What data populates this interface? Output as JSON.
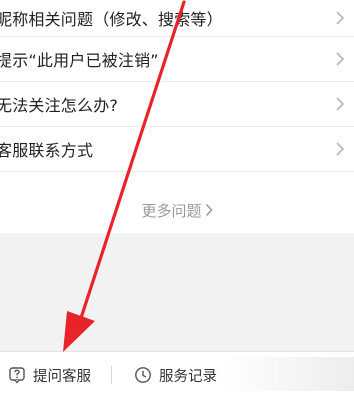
{
  "faq": {
    "items": [
      {
        "label": "昵称相关问题（修改、搜索等）"
      },
      {
        "label": "提示“此用户已被注销”"
      },
      {
        "label": "无法关注怎么办?"
      },
      {
        "label": "客服联系方式"
      }
    ],
    "more_label": "更多问题"
  },
  "bottom_bar": {
    "ask_label": "提问客服",
    "record_label": "服务记录"
  },
  "colors": {
    "annotation_arrow": "#e8232a",
    "background_gray": "#f2f2f3",
    "muted_text": "#9a9a9a"
  }
}
